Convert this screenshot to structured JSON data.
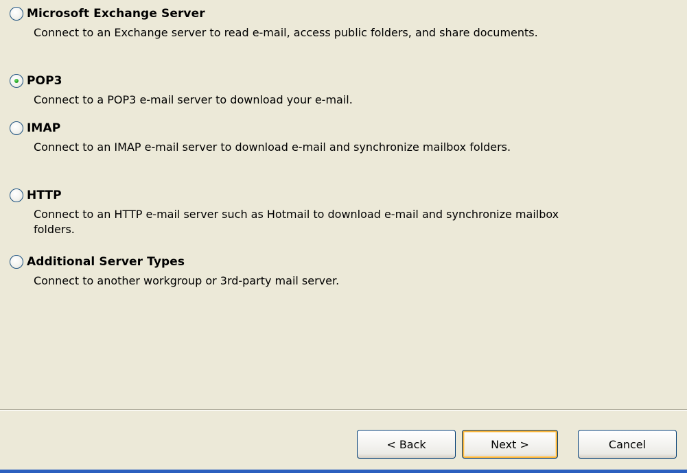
{
  "options": [
    {
      "label": "Microsoft Exchange Server",
      "description": "Connect to an Exchange server to read e-mail, access public folders, and share documents.",
      "checked": false
    },
    {
      "label": "POP3",
      "description": "Connect to a POP3 e-mail server to download your e-mail.",
      "checked": true
    },
    {
      "label": "IMAP",
      "description": "Connect to an IMAP e-mail server to download e-mail and synchronize mailbox folders.",
      "checked": false
    },
    {
      "label": "HTTP",
      "description": "Connect to an HTTP e-mail server such as Hotmail to download e-mail and synchronize mailbox folders.",
      "checked": false
    },
    {
      "label": "Additional Server Types",
      "description": "Connect to another workgroup or 3rd-party mail server.",
      "checked": false
    }
  ],
  "buttons": {
    "back": "< Back",
    "next": "Next >",
    "cancel": "Cancel"
  },
  "colors": {
    "background": "#ece9d8",
    "default_button_highlight": "#f8b53d",
    "radio_selected": "#21a121",
    "bottom_bar": "#2b5fbf"
  }
}
